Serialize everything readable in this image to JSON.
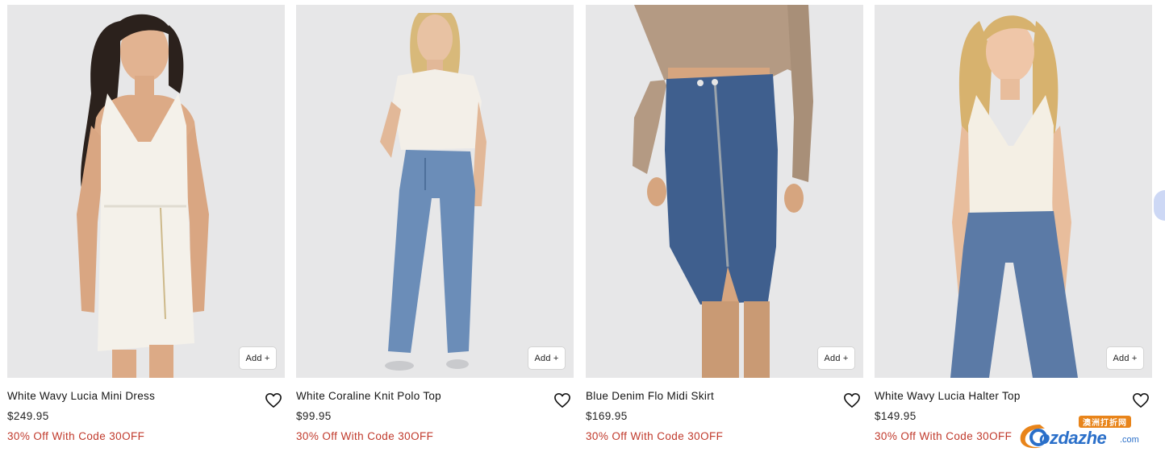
{
  "products": [
    {
      "name": "White Wavy Lucia Mini Dress",
      "price": "$249.95",
      "promo": "30% Off With Code 30OFF",
      "add_label": "Add +",
      "photo": "model-white-knit-halter-mini-dress"
    },
    {
      "name": "White Coraline Knit Polo Top",
      "price": "$99.95",
      "promo": "30% Off With Code 30OFF",
      "add_label": "Add +",
      "photo": "model-white-fuzzy-polo-and-straight-jeans"
    },
    {
      "name": "Blue Denim Flo Midi Skirt",
      "price": "$169.95",
      "promo": "30% Off With Code 30OFF",
      "add_label": "Add +",
      "photo": "model-denim-zip-midi-skirt"
    },
    {
      "name": "White Wavy Lucia Halter Top",
      "price": "$149.95",
      "promo": "30% Off With Code 30OFF",
      "add_label": "Add +",
      "photo": "model-white-knit-halter-top-and-wide-jeans"
    }
  ],
  "watermark": {
    "badge": "澳洲打折网",
    "text": "ozdazhe",
    "domain": ".com"
  },
  "colors": {
    "promo": "#c0392b",
    "photo_bg": "#e7e7e8",
    "denim": "#3f5f8e",
    "watermark_blue": "#2a6fc9"
  },
  "icons": {
    "wishlist": "heart-outline-icon",
    "carousel": "carousel-next-tab"
  }
}
